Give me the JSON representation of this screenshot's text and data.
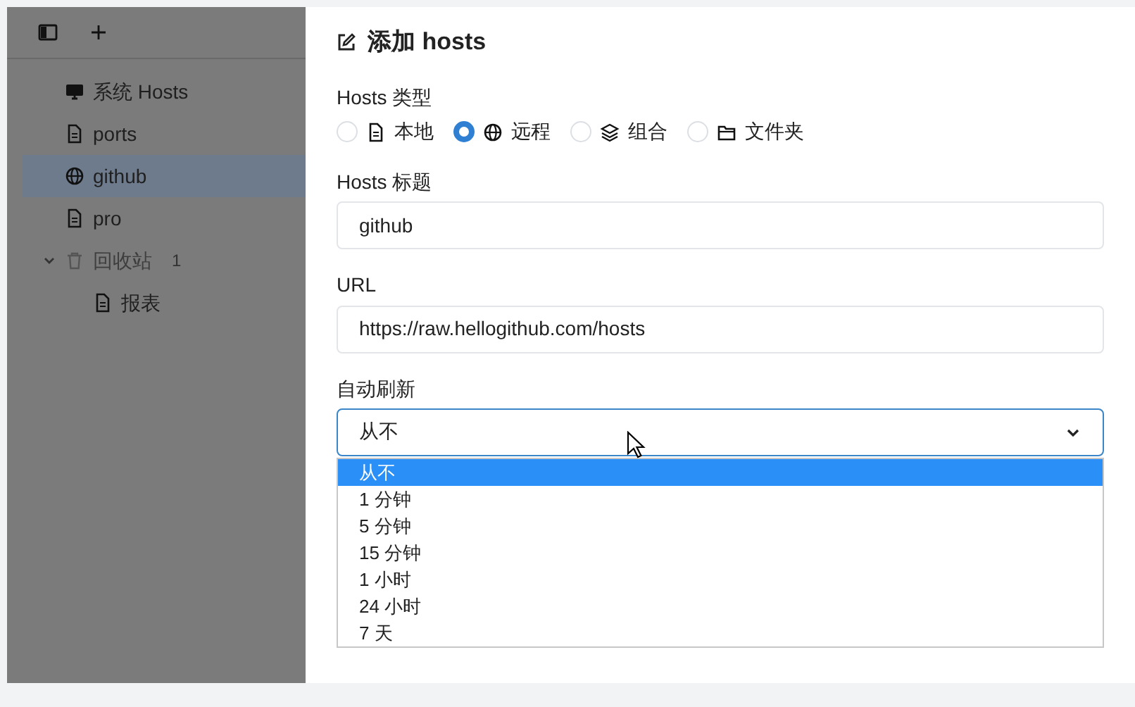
{
  "sidebar": {
    "items": [
      {
        "label": "系统 Hosts",
        "kind": "monitor",
        "selected": false,
        "disabled": false
      },
      {
        "label": "ports",
        "kind": "file",
        "selected": false,
        "disabled": false
      },
      {
        "label": "github",
        "kind": "globe",
        "selected": true,
        "disabled": false
      },
      {
        "label": "pro",
        "kind": "file",
        "selected": false,
        "disabled": false
      },
      {
        "label": "回收站",
        "kind": "trash",
        "count": "1",
        "selected": false,
        "disabled": true,
        "expanded": true,
        "children": [
          {
            "label": "报表",
            "kind": "file",
            "selected": false,
            "disabled": false
          }
        ]
      }
    ]
  },
  "drawer": {
    "title": "添加 hosts",
    "type_field": {
      "label": "Hosts 类型",
      "options": [
        {
          "label": "本地",
          "kind": "file",
          "selected": false
        },
        {
          "label": "远程",
          "kind": "globe",
          "selected": true
        },
        {
          "label": "组合",
          "kind": "layers",
          "selected": false
        },
        {
          "label": "文件夹",
          "kind": "folder",
          "selected": false
        }
      ]
    },
    "title_field": {
      "label": "Hosts 标题",
      "value": "github"
    },
    "url_field": {
      "label": "URL",
      "value": "https://raw.hellogithub.com/hosts"
    },
    "refresh_field": {
      "label": "自动刷新",
      "value": "从不",
      "open": true,
      "options": [
        {
          "label": "从不",
          "selected": true
        },
        {
          "label": "1 分钟",
          "selected": false
        },
        {
          "label": "5 分钟",
          "selected": false
        },
        {
          "label": "15 分钟",
          "selected": false
        },
        {
          "label": "1 小时",
          "selected": false
        },
        {
          "label": "24 小时",
          "selected": false
        },
        {
          "label": "7 天",
          "selected": false
        }
      ]
    }
  }
}
